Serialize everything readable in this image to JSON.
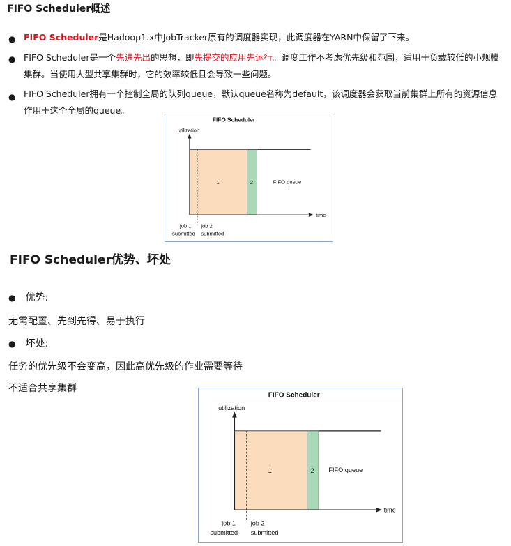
{
  "section1": {
    "title": "FIFO Scheduler概述",
    "bullet_glyph": "●",
    "p1": {
      "highlight": "FIFO Scheduler",
      "rest": "是Hadoop1.x中JobTracker原有的调度器实现，此调度器在YARN中保留了下来。"
    },
    "p2": {
      "part1": "FIFO Scheduler是一个",
      "red1": "先进先出",
      "part2": "的思想，即",
      "red2": "先提交的应用先运行",
      "part3": "。调度工作不考虑优先级和范围，适用于负载较低的小规模集群。当使用大型共享集群时，它的效率较低且会导致一些问题。"
    },
    "p3": "FIFO Scheduler拥有一个控制全局的队列queue，默认queue名称为default，该调度器会获取当前集群上所有的资源信息作用于这个全局的queue。"
  },
  "figure": {
    "title": "FIFO Scheduler",
    "ylabel": "utilization",
    "xlabel": "time",
    "job1_label": "1",
    "job2_label": "2",
    "queue_label": "FIFO queue",
    "job1_submitted_line1": "job 1",
    "job1_submitted_line2": "submitted",
    "job2_submitted_line1": "job 2",
    "job2_submitted_line2": "submitted",
    "colors": {
      "job1": "#fbdcbd",
      "job2": "#a9d9b6",
      "frame": "#8aa6c8"
    }
  },
  "section2": {
    "title": "FIFO Scheduler优势、坏处",
    "adv_label": "优势:",
    "adv_text": "无需配置、先到先得、易于执行",
    "dis_label": "坏处:",
    "dis_text1": "任务的优先级不会变高，因此高优先级的作业需要等待",
    "dis_text2": "不适合共享集群"
  }
}
